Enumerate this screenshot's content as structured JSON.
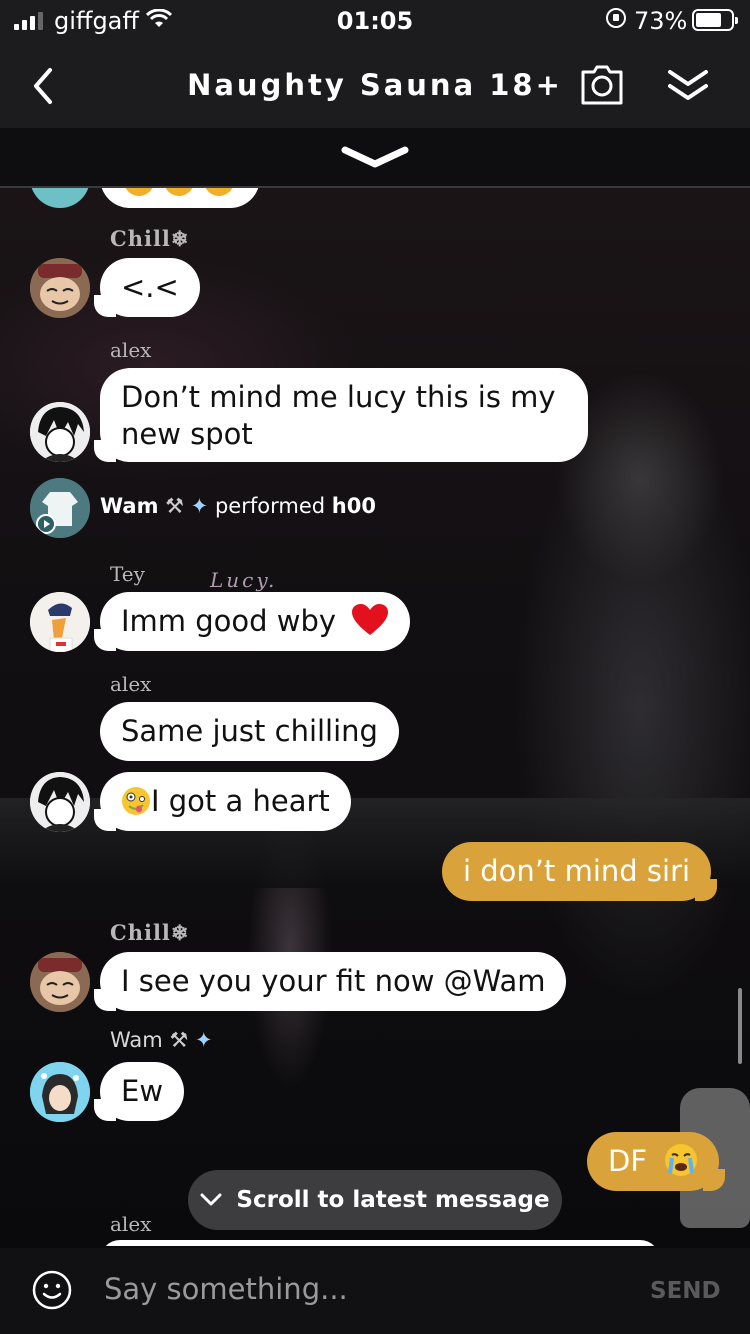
{
  "status_bar": {
    "carrier": "giffgaff",
    "time": "01:05",
    "battery": "73%",
    "battery_level": 0.73
  },
  "header": {
    "title": "Naughty Sauna 18+"
  },
  "messages": [
    {
      "sender": "Chill❄",
      "text": "<.<"
    },
    {
      "sender": "alex",
      "text_line1": "Don’t mind me lucy this is my",
      "text_line2": "new spot"
    },
    {
      "action_user": "Wam",
      "action_verb": "performed",
      "action_object": "h00"
    },
    {
      "sender": "Tey",
      "text": "Imm good wby"
    },
    {
      "sender": "alex",
      "text": "Same just chilling",
      "text2": "I got a heart"
    },
    {
      "me": true,
      "text": "i don’t mind siri"
    },
    {
      "sender": "Chill❄",
      "text": "I see you your fit now @Wam"
    },
    {
      "sender": "Wam",
      "text": "Ew"
    },
    {
      "me": true,
      "text": "DF"
    },
    {
      "sender": "alex"
    }
  ],
  "scene_label": "Lucy.",
  "scroll_button": {
    "label": "Scroll to latest message"
  },
  "composer": {
    "placeholder": "Say something...",
    "send_label": "SEND"
  },
  "colors": {
    "my_bubble": "#d9a23a",
    "bar": "#1c1c1e"
  }
}
